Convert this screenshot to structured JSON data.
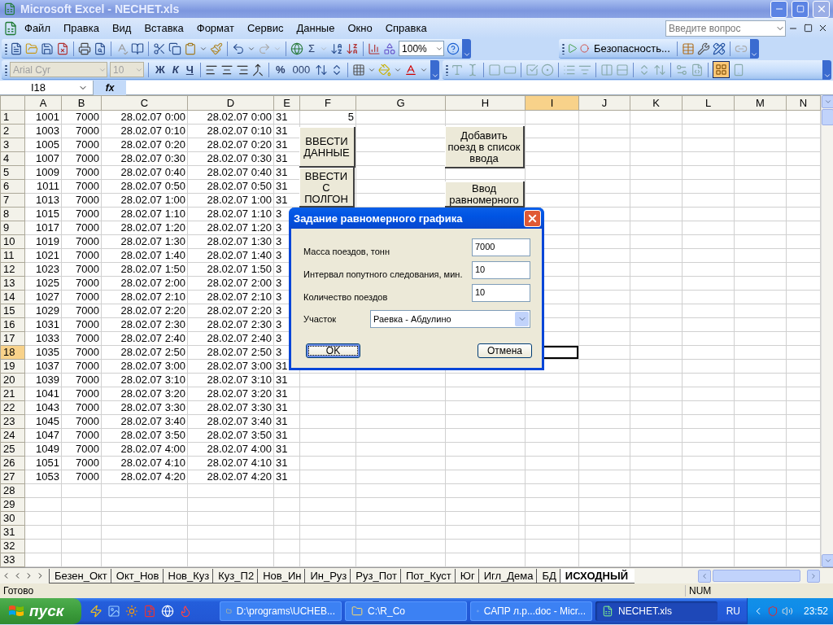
{
  "window": {
    "title": "Microsoft Excel - NECHET.xls"
  },
  "menu": {
    "items": [
      "Файл",
      "Правка",
      "Вид",
      "Вставка",
      "Формат",
      "Сервис",
      "Данные",
      "Окно",
      "Справка"
    ],
    "help_field": {
      "placeholder": "Введите вопрос"
    }
  },
  "standard_toolbar": {
    "autosum": "Σ",
    "zoom": "100%"
  },
  "macro_toolbar": {
    "security": "Безопасность..."
  },
  "format_toolbar": {
    "font": {
      "value": "Arial Cyr",
      "disabled": true
    },
    "size": {
      "value": "10",
      "disabled": true
    },
    "bold": "Ж",
    "italic": "К",
    "underline": "Ч",
    "percent": "%",
    "thousands": "000"
  },
  "formula_bar": {
    "name_box": "I18",
    "function_label": "fx"
  },
  "sheet": {
    "columns": [
      {
        "label": "A",
        "selected": false
      },
      {
        "label": "B",
        "selected": false
      },
      {
        "label": "C",
        "selected": false
      },
      {
        "label": "D",
        "selected": false
      },
      {
        "label": "E",
        "selected": false
      },
      {
        "label": "F",
        "selected": false
      },
      {
        "label": "G",
        "selected": false
      },
      {
        "label": "H",
        "selected": false
      },
      {
        "label": "I",
        "selected": true
      },
      {
        "label": "J",
        "selected": false
      },
      {
        "label": "K",
        "selected": false
      },
      {
        "label": "L",
        "selected": false
      },
      {
        "label": "M",
        "selected": false
      },
      {
        "label": "N",
        "selected": false
      }
    ],
    "rows": [
      {
        "header": "1",
        "selected": false,
        "cells": [
          "1001",
          "7000",
          "28.02.07 0:00",
          "28.02.07 0:00",
          "31",
          "5"
        ]
      },
      {
        "header": "2",
        "selected": false,
        "cells": [
          "1003",
          "7000",
          "28.02.07 0:10",
          "28.02.07 0:10",
          "31"
        ]
      },
      {
        "header": "3",
        "selected": false,
        "cells": [
          "1005",
          "7000",
          "28.02.07 0:20",
          "28.02.07 0:20",
          "31"
        ]
      },
      {
        "header": "4",
        "selected": false,
        "cells": [
          "1007",
          "7000",
          "28.02.07 0:30",
          "28.02.07 0:30",
          "31"
        ]
      },
      {
        "header": "5",
        "selected": false,
        "cells": [
          "1009",
          "7000",
          "28.02.07 0:40",
          "28.02.07 0:40",
          "31"
        ]
      },
      {
        "header": "6",
        "selected": false,
        "cells": [
          "1011",
          "7000",
          "28.02.07 0:50",
          "28.02.07 0:50",
          "31"
        ]
      },
      {
        "header": "7",
        "selected": false,
        "cells": [
          "1013",
          "7000",
          "28.02.07 1:00",
          "28.02.07 1:00",
          "31"
        ]
      },
      {
        "header": "8",
        "selected": false,
        "cells": [
          "1015",
          "7000",
          "28.02.07 1:10",
          "28.02.07 1:10",
          "3"
        ]
      },
      {
        "header": "9",
        "selected": false,
        "cells": [
          "1017",
          "7000",
          "28.02.07 1:20",
          "28.02.07 1:20",
          "3"
        ]
      },
      {
        "header": "10",
        "selected": false,
        "cells": [
          "1019",
          "7000",
          "28.02.07 1:30",
          "28.02.07 1:30",
          "3"
        ]
      },
      {
        "header": "11",
        "selected": false,
        "cells": [
          "1021",
          "7000",
          "28.02.07 1:40",
          "28.02.07 1:40",
          "3"
        ]
      },
      {
        "header": "12",
        "selected": false,
        "cells": [
          "1023",
          "7000",
          "28.02.07 1:50",
          "28.02.07 1:50",
          "3"
        ]
      },
      {
        "header": "13",
        "selected": false,
        "cells": [
          "1025",
          "7000",
          "28.02.07 2:00",
          "28.02.07 2:00",
          "3"
        ]
      },
      {
        "header": "14",
        "selected": false,
        "cells": [
          "1027",
          "7000",
          "28.02.07 2:10",
          "28.02.07 2:10",
          "3"
        ]
      },
      {
        "header": "15",
        "selected": false,
        "cells": [
          "1029",
          "7000",
          "28.02.07 2:20",
          "28.02.07 2:20",
          "3"
        ]
      },
      {
        "header": "16",
        "selected": false,
        "cells": [
          "1031",
          "7000",
          "28.02.07 2:30",
          "28.02.07 2:30",
          "3"
        ]
      },
      {
        "header": "17",
        "selected": false,
        "cells": [
          "1033",
          "7000",
          "28.02.07 2:40",
          "28.02.07 2:40",
          "3"
        ]
      },
      {
        "header": "18",
        "selected": true,
        "cells": [
          "1035",
          "7000",
          "28.02.07 2:50",
          "28.02.07 2:50",
          "3"
        ]
      },
      {
        "header": "19",
        "selected": false,
        "cells": [
          "1037",
          "7000",
          "28.02.07 3:00",
          "28.02.07 3:00",
          "31"
        ]
      },
      {
        "header": "20",
        "selected": false,
        "cells": [
          "1039",
          "7000",
          "28.02.07 3:10",
          "28.02.07 3:10",
          "31"
        ]
      },
      {
        "header": "21",
        "selected": false,
        "cells": [
          "1041",
          "7000",
          "28.02.07 3:20",
          "28.02.07 3:20",
          "31"
        ]
      },
      {
        "header": "22",
        "selected": false,
        "cells": [
          "1043",
          "7000",
          "28.02.07 3:30",
          "28.02.07 3:30",
          "31"
        ]
      },
      {
        "header": "23",
        "selected": false,
        "cells": [
          "1045",
          "7000",
          "28.02.07 3:40",
          "28.02.07 3:40",
          "31"
        ]
      },
      {
        "header": "24",
        "selected": false,
        "cells": [
          "1047",
          "7000",
          "28.02.07 3:50",
          "28.02.07 3:50",
          "31"
        ]
      },
      {
        "header": "25",
        "selected": false,
        "cells": [
          "1049",
          "7000",
          "28.02.07 4:00",
          "28.02.07 4:00",
          "31"
        ]
      },
      {
        "header": "26",
        "selected": false,
        "cells": [
          "1051",
          "7000",
          "28.02.07 4:10",
          "28.02.07 4:10",
          "31"
        ]
      },
      {
        "header": "27",
        "selected": false,
        "cells": [
          "1053",
          "7000",
          "28.02.07 4:20",
          "28.02.07 4:20",
          "31"
        ]
      },
      {
        "header": "28",
        "selected": false
      },
      {
        "header": "29",
        "selected": false
      },
      {
        "header": "30",
        "selected": false
      },
      {
        "header": "31",
        "selected": false
      },
      {
        "header": "32",
        "selected": false
      },
      {
        "header": "33",
        "selected": false
      }
    ]
  },
  "sheet_buttons": [
    {
      "label": "ВВЕСТИ ДАННЫЕ"
    },
    {
      "label": "ВВЕСТИ С ПОЛГОН"
    },
    {
      "label": "Добавить поезд в список ввода"
    },
    {
      "label": "Ввод равномерного"
    }
  ],
  "dialog": {
    "title": "Задание равномерного графика",
    "fields": [
      {
        "kind": "text",
        "label": "Масса поездов, тонн",
        "value": "7000"
      },
      {
        "kind": "text",
        "label": "Интервал попутного следования, мин.",
        "value": "10"
      },
      {
        "kind": "text",
        "label": "Количество поездов",
        "value": "10"
      },
      {
        "kind": "combo",
        "label": "Участок",
        "value": "Раевка - Абдулино"
      }
    ],
    "buttons": [
      {
        "label": "OK",
        "default": true
      },
      {
        "label": "Отмена",
        "default": false
      }
    ]
  },
  "sheet_tabs": [
    {
      "label": "Безен_Окт",
      "selected": false
    },
    {
      "label": "Окт_Нов",
      "selected": false
    },
    {
      "label": "Нов_Куз",
      "selected": false
    },
    {
      "label": "Куз_П2",
      "selected": false
    },
    {
      "label": "Нов_Ин",
      "selected": false
    },
    {
      "label": "Ин_Руз",
      "selected": false
    },
    {
      "label": "Руз_Пот",
      "selected": false
    },
    {
      "label": "Пот_Куст",
      "selected": false
    },
    {
      "label": "Юг",
      "selected": false
    },
    {
      "label": "Игл_Дема",
      "selected": false
    },
    {
      "label": "БД",
      "selected": false
    },
    {
      "label": "ИСХОДНЫЙ",
      "selected": true
    }
  ],
  "status_bar": {
    "text": "Готово",
    "num": "NUM"
  },
  "taskbar": {
    "start": "пуск",
    "tasks": [
      {
        "label": "D:\\programs\\UCHEB...",
        "selected": false
      },
      {
        "label": "C:\\R_Co",
        "selected": false
      },
      {
        "label": "САПР л.р...doc - Micr...",
        "selected": false
      },
      {
        "label": "NECHET.xls",
        "selected": true
      }
    ],
    "language": "RU",
    "time": "23:52"
  }
}
